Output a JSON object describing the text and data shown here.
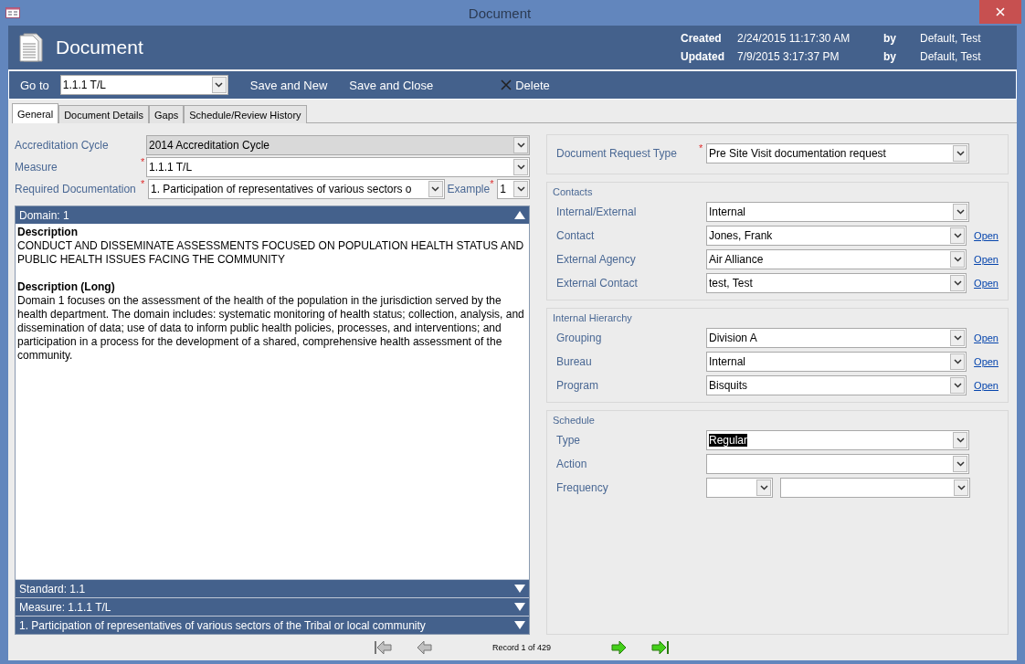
{
  "window": {
    "title": "Document"
  },
  "header": {
    "title": "Document",
    "meta": [
      {
        "label": "Created",
        "value": "2/24/2015 11:17:30 AM",
        "by": "by",
        "user": "Default, Test"
      },
      {
        "label": "Updated",
        "value": "7/9/2015 3:17:37 PM",
        "by": "by",
        "user": "Default, Test"
      }
    ]
  },
  "toolbar": {
    "goto_label": "Go to",
    "goto_value": "1.1.1 T/L",
    "actions": [
      {
        "kind": "plain",
        "label": "Save and New"
      },
      {
        "kind": "plain",
        "label": "Save and Close"
      },
      {
        "kind": "delete",
        "label": "Delete"
      }
    ]
  },
  "tabs": [
    {
      "label": "General",
      "selected": true
    },
    {
      "label": "Document Details",
      "selected": false
    },
    {
      "label": "Gaps",
      "selected": false
    },
    {
      "label": "Schedule/Review History",
      "selected": false
    }
  ],
  "left_fields": [
    {
      "label": "Accreditation Cycle",
      "value": "2014 Accreditation Cycle",
      "disabled": true
    },
    {
      "label": "Measure",
      "required_mark": "*",
      "value": "1.1.1 T/L",
      "disabled": false
    }
  ],
  "required_doc": {
    "label": "Required Documentation",
    "required_mark": "*",
    "value": "1. Participation of representatives of various sectors o",
    "example_label": "Example",
    "example_required_mark": "*",
    "example_value": "1"
  },
  "sections": [
    {
      "title": "Domain: 1",
      "expanded": true,
      "blocks": [
        {
          "heading": "Description",
          "text": "CONDUCT AND DISSEMINATE ASSESSMENTS FOCUSED ON POPULATION HEALTH STATUS AND PUBLIC HEALTH ISSUES FACING THE COMMUNITY"
        },
        {
          "heading": "Description (Long)",
          "text": "Domain 1 focuses on the assessment of the health of the population in the jurisdiction served by the health department. The domain includes: systematic monitoring of health status; collection, analysis, and dissemination of data; use of data to inform public health policies, processes, and interventions; and participation in a process for the development of a shared, comprehensive health assessment of the community."
        }
      ]
    },
    {
      "title": "Standard: 1.1",
      "expanded": false
    },
    {
      "title": "Measure: 1.1.1 T/L",
      "expanded": false
    },
    {
      "title": "1. Participation of representatives of various sectors of the Tribal or local community",
      "expanded": false
    }
  ],
  "request_type": {
    "label": "Document Request Type",
    "required_mark": "*",
    "value": "Pre Site Visit documentation request"
  },
  "groups": [
    {
      "title": "Contacts",
      "fields": [
        {
          "label": "Internal/External",
          "value": "Internal"
        },
        {
          "label": "Contact",
          "value": "Jones, Frank",
          "link": "Open"
        },
        {
          "label": "External Agency",
          "value": "Air Alliance",
          "link": "Open"
        },
        {
          "label": "External Contact",
          "value": "test, Test",
          "link": "Open"
        }
      ]
    },
    {
      "title": "Internal Hierarchy",
      "fields": [
        {
          "label": "Grouping",
          "value": "Division A",
          "link": "Open"
        },
        {
          "label": "Bureau",
          "value": "Internal",
          "link": "Open"
        },
        {
          "label": "Program",
          "value": "Bisquits",
          "link": "Open"
        }
      ]
    }
  ],
  "schedule": {
    "title": "Schedule",
    "type_label": "Type",
    "type_value": "Regular",
    "type_highlighted": true,
    "action_label": "Action",
    "frequency_label": "Frequency"
  },
  "navigator": {
    "record": "Record 1 of 429",
    "buttons": [
      {
        "kind": "first",
        "disabled": true
      },
      {
        "kind": "prev",
        "disabled": true
      },
      {
        "kind": "next",
        "disabled": false
      },
      {
        "kind": "last",
        "disabled": false
      }
    ]
  }
}
